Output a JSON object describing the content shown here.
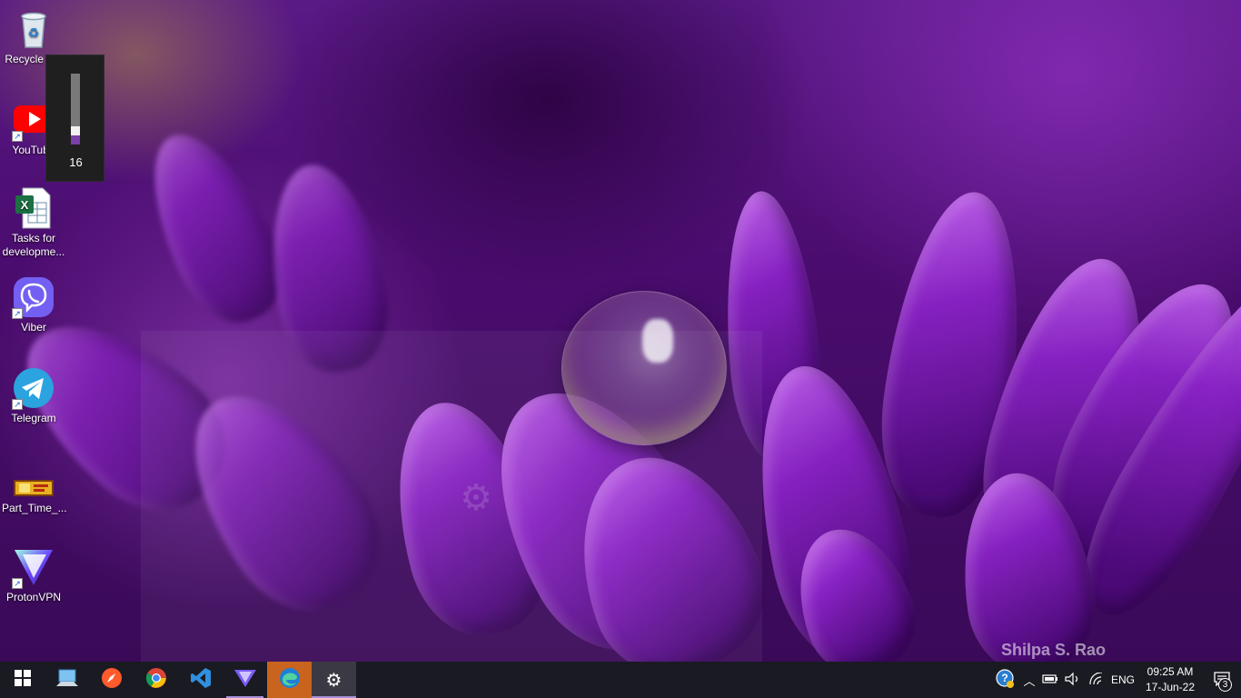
{
  "desktop": {
    "watermark": "Shilpa S. Rao",
    "icons": [
      {
        "label": "Recycle Bin",
        "icon": "recycle-bin-icon"
      },
      {
        "label": "YouTube",
        "icon": "youtube-icon"
      },
      {
        "label": "Tasks for developme...",
        "icon": "excel-file-icon"
      },
      {
        "label": "Viber",
        "icon": "viber-icon"
      },
      {
        "label": "Telegram",
        "icon": "telegram-icon"
      },
      {
        "label": "Part_Time_...",
        "icon": "image-file-icon"
      },
      {
        "label": "ProtonVPN",
        "icon": "protonvpn-icon"
      }
    ]
  },
  "volume": {
    "value": "16",
    "level_percent": 16,
    "accent": "#7a3fa8"
  },
  "taskbar": {
    "apps": [
      {
        "name": "Start",
        "icon": "windows-start-icon"
      },
      {
        "name": "This PC",
        "icon": "this-pc-icon"
      },
      {
        "name": "Brave-like browser",
        "icon": "compass-browser-icon"
      },
      {
        "name": "Google Chrome",
        "icon": "chrome-icon"
      },
      {
        "name": "Visual Studio Code",
        "icon": "vscode-icon"
      },
      {
        "name": "ProtonVPN",
        "icon": "protonvpn-icon"
      },
      {
        "name": "Microsoft Edge",
        "icon": "edge-icon"
      },
      {
        "name": "Settings",
        "icon": "settings-gear-icon"
      }
    ],
    "tray": {
      "language": "ENG",
      "time": "09:25 AM",
      "date": "17-Jun-22",
      "notifications_count": "3"
    }
  }
}
